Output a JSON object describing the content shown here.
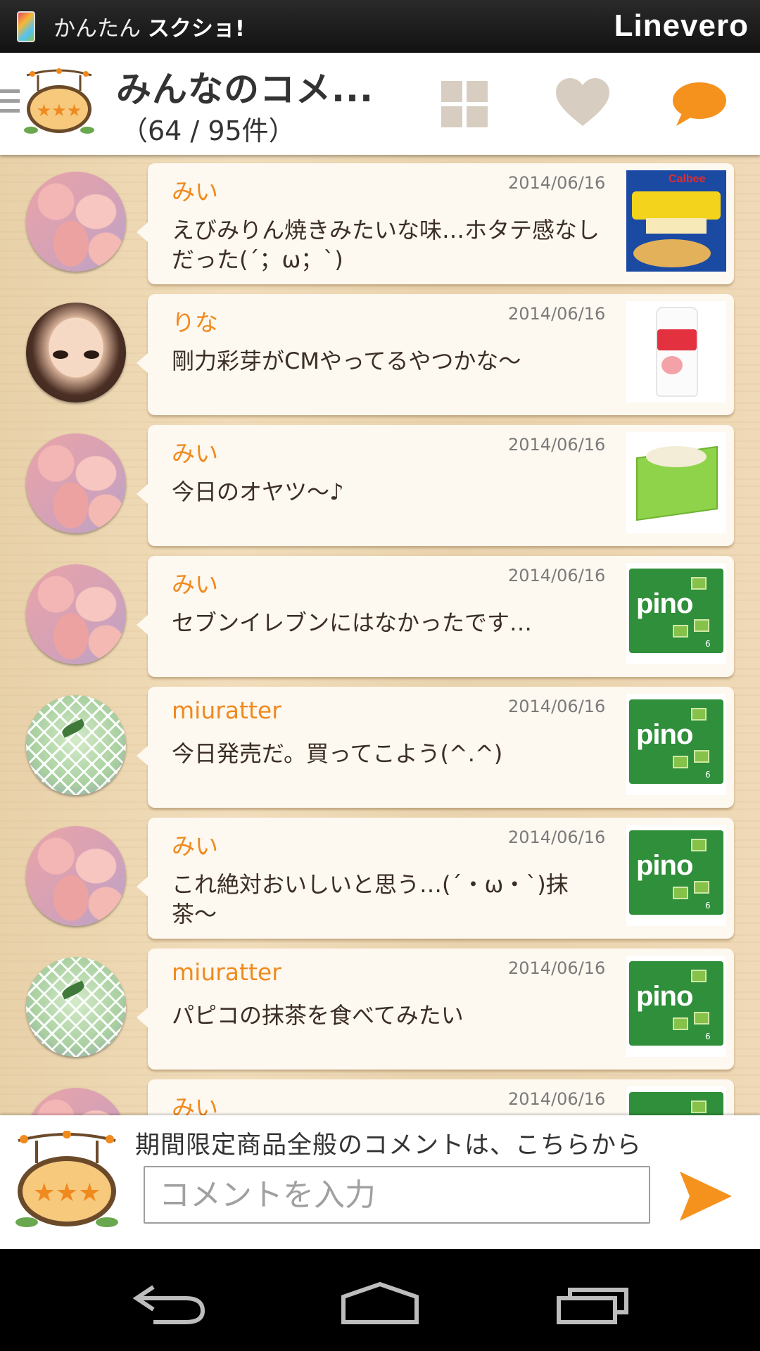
{
  "status_bar": {
    "app_prefix": "かんたん",
    "app_bold": "スクショ!",
    "brand": "Linevero"
  },
  "header": {
    "title": "みんなのコメ...",
    "count": "（64 / 95件）"
  },
  "comments": [
    {
      "name": "みい",
      "date": "2014/06/16",
      "text": "えびみりん焼きみたいな味…ホタテ感なしだった(´；ω；`)"
    },
    {
      "name": "りな",
      "date": "2014/06/16",
      "text": "剛力彩芽がCMやってるやつかな〜"
    },
    {
      "name": "みい",
      "date": "2014/06/16",
      "text": "今日のオヤツ〜♪"
    },
    {
      "name": "みい",
      "date": "2014/06/16",
      "text": "セブンイレブンにはなかったです…"
    },
    {
      "name": "miuratter",
      "date": "2014/06/16",
      "text": "今日発売だ。買ってこよう(^.^)"
    },
    {
      "name": "みい",
      "date": "2014/06/16",
      "text": "これ絶対おいしいと思う…(´・ω・`)抹茶〜"
    },
    {
      "name": "miuratter",
      "date": "2014/06/16",
      "text": "パピコの抹茶を食べてみたい"
    },
    {
      "name": "みい",
      "date": "2014/06/16",
      "text": ""
    }
  ],
  "products": {
    "chips_brand": "Calbee",
    "pino_logo": "pino",
    "pino_count": "6"
  },
  "compose": {
    "hint": "期間限定商品全般のコメントは、こちらから",
    "placeholder": "コメントを入力"
  },
  "colors": {
    "accent_orange": "#f08a1e",
    "header_icon": "#d7cec1",
    "chat_icon": "#f5921e"
  },
  "icons": [
    "menu-icon",
    "grid-icon",
    "heart-icon",
    "chat-icon",
    "send-icon",
    "back-icon",
    "home-icon",
    "recent-apps-icon"
  ]
}
